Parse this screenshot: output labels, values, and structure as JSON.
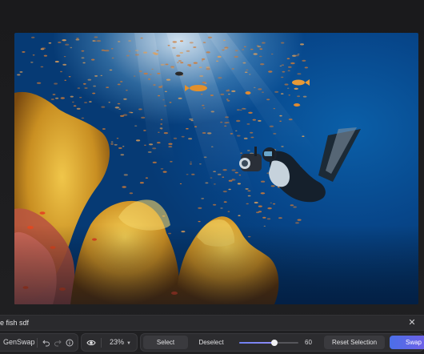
{
  "prompt": {
    "value": "ore fish sdf",
    "close_icon": "close-icon"
  },
  "toolbar": {
    "app_name": "GenSwap",
    "undo_icon": "undo-icon",
    "redo_icon": "redo-icon",
    "info_icon": "info-icon",
    "view_icon": "eye-icon",
    "zoom": "23%",
    "select_label": "Select",
    "deselect_label": "Deselect",
    "brush_size": {
      "value": "60",
      "fraction": 0.6
    },
    "reset_label": "Reset Selection",
    "swap_label": "Swap"
  },
  "colors": {
    "background": "#1d1d1f",
    "toolbar_group": "#2c2c2f",
    "accent_start": "#4b6fe8",
    "accent_end": "#7a5ce6"
  }
}
